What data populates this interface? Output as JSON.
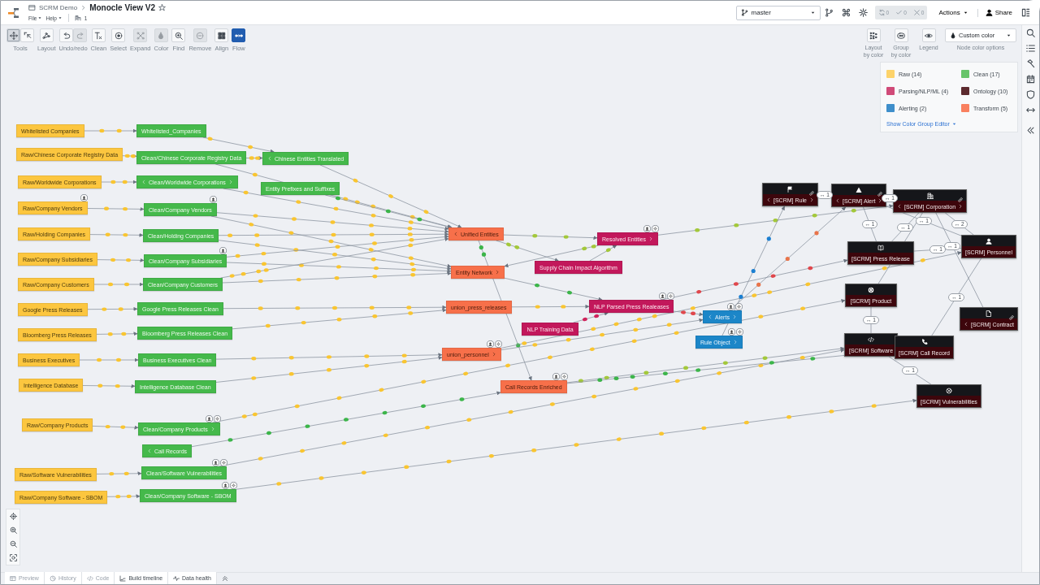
{
  "header": {
    "breadcrumb": "SCRM Demo",
    "title": "Monocle View V2",
    "menus": [
      "File",
      "Help"
    ],
    "counter": "1"
  },
  "branch": {
    "value": "master"
  },
  "checks": [
    {
      "count": "0"
    },
    {
      "count": "0"
    },
    {
      "count": "0"
    }
  ],
  "actions": "Actions",
  "share": "Share",
  "toolbar": [
    {
      "label": "Tools",
      "buttons": [
        {
          "selected": true,
          "disabled": false
        },
        {
          "selected": false,
          "disabled": false
        }
      ]
    },
    {
      "label": "Layout",
      "buttons": [
        {
          "selected": false,
          "disabled": false
        }
      ]
    },
    {
      "label": "Undo/redo",
      "buttons": [
        {
          "selected": false,
          "disabled": false
        },
        {
          "selected": false,
          "disabled": true
        }
      ]
    },
    {
      "label": "Clean",
      "buttons": [
        {
          "selected": false,
          "disabled": false
        }
      ]
    },
    {
      "label": "Select",
      "buttons": [
        {
          "selected": false,
          "disabled": false
        }
      ]
    },
    {
      "label": "Expand",
      "buttons": [
        {
          "selected": false,
          "disabled": true
        }
      ]
    },
    {
      "label": "Color",
      "buttons": [
        {
          "selected": false,
          "disabled": true
        }
      ]
    },
    {
      "label": "Find",
      "buttons": [
        {
          "selected": false,
          "disabled": false
        }
      ]
    },
    {
      "label": "Remove",
      "buttons": [
        {
          "selected": false,
          "disabled": true
        }
      ]
    },
    {
      "label": "Align",
      "buttons": [
        {
          "selected": false,
          "disabled": false
        }
      ]
    },
    {
      "label": "Flow",
      "buttons": [
        {
          "selected": true,
          "disabled": false
        }
      ]
    }
  ],
  "color_tools": [
    {
      "label": "Layout by color"
    },
    {
      "label": "Group by color"
    },
    {
      "label": "Legend"
    }
  ],
  "color_dropdown": {
    "value": "Custom color",
    "caption": "Node color options"
  },
  "legend": {
    "items": [
      {
        "label": "Raw (14)",
        "color": "#fdd36a"
      },
      {
        "label": "Clean (17)",
        "color": "#67c46a"
      },
      {
        "label": "Parsing/NLP/ML (4)",
        "color": "#d04a78"
      },
      {
        "label": "Ontology (10)",
        "color": "#5c2a2e"
      },
      {
        "label": "Alerting (2)",
        "color": "#3f8fcb"
      },
      {
        "label": "Transform (5)",
        "color": "#f9805f"
      }
    ],
    "editor_link": "Show Color Group Editor"
  },
  "nodes": [
    {
      "label": "Whitelisted Companies",
      "kind": "raw"
    },
    {
      "label": "Raw/Chinese Corporate Registry Data",
      "kind": "raw"
    },
    {
      "label": "Raw/Worldwide Corporations",
      "kind": "raw"
    },
    {
      "label": "Raw/Company Vendors",
      "kind": "raw",
      "user_badge": true
    },
    {
      "label": "Raw/Holding Companies",
      "kind": "raw"
    },
    {
      "label": "Raw/Company Subsidiaries",
      "kind": "raw"
    },
    {
      "label": "Raw/Company Customers",
      "kind": "raw"
    },
    {
      "label": "Google Press Releases",
      "kind": "raw"
    },
    {
      "label": "Bloomberg Press Releases",
      "kind": "raw"
    },
    {
      "label": "Business Executives",
      "kind": "raw"
    },
    {
      "label": "Intelligence Database",
      "kind": "raw"
    },
    {
      "label": "Raw/Company Products",
      "kind": "raw"
    },
    {
      "label": "Raw/Software Vulnerabilities",
      "kind": "raw"
    },
    {
      "label": "Raw/Company Software - SBOM",
      "kind": "raw"
    },
    {
      "label": "Whitelisted_Companies",
      "kind": "clean"
    },
    {
      "label": "Clean/Chinese Corporate Registry Data",
      "kind": "clean"
    },
    {
      "label": "Clean/Worldwide Corporations",
      "kind": "clean",
      "expand_left": true,
      "expand_right": true
    },
    {
      "label": "Clean/Company Vendors",
      "kind": "clean",
      "user_badge": true
    },
    {
      "label": "Clean/Holding Companies",
      "kind": "clean"
    },
    {
      "label": "Clean/Company Subsidiaries",
      "kind": "clean",
      "user_badge": true
    },
    {
      "label": "Clean/Company Customers",
      "kind": "clean"
    },
    {
      "label": "Google Press Releases Clean",
      "kind": "clean"
    },
    {
      "label": "Bloomberg Press Releases Clean",
      "kind": "clean"
    },
    {
      "label": "Business Executives Clean",
      "kind": "clean"
    },
    {
      "label": "Intelligence Database Clean",
      "kind": "clean"
    },
    {
      "label": "Clean/Company Products",
      "kind": "clean",
      "expand_right": true,
      "user_badge": true,
      "gear_badge": true
    },
    {
      "label": "Call Records",
      "kind": "clean",
      "expand_left": true
    },
    {
      "label": "Clean/Software Vulnerabilities",
      "kind": "clean",
      "user_badge": true,
      "gear_badge": true
    },
    {
      "label": "Clean/Company Software - SBOM",
      "kind": "clean",
      "user_badge": true,
      "gear_badge": true
    },
    {
      "label": "Chinese Entities Translated",
      "kind": "clean",
      "expand_left": true
    },
    {
      "label": "Entity Prefixes and Suffixes",
      "kind": "clean"
    },
    {
      "label": "Unified Entities",
      "kind": "transform",
      "expand_left": true
    },
    {
      "label": "Entity Network",
      "kind": "transform",
      "expand_right": true
    },
    {
      "label": "union_press_releases",
      "kind": "transform"
    },
    {
      "label": "union_personnel",
      "kind": "transform",
      "expand_right": true,
      "user_badge": true,
      "gear_badge": true
    },
    {
      "label": "Call Records Enriched",
      "kind": "transform",
      "user_badge": true,
      "gear_badge": true
    },
    {
      "label": "Resolved Entities",
      "kind": "parsing",
      "expand_right": true,
      "user_badge": true,
      "gear_badge": true
    },
    {
      "label": "Supply Chain Impact Algorithm",
      "kind": "parsing"
    },
    {
      "label": "NLP Parsed Press Realeases",
      "kind": "parsing",
      "user_badge": true,
      "gear_badge": true
    },
    {
      "label": "NLP Training Data",
      "kind": "parsing"
    },
    {
      "label": "Alerts",
      "kind": "alerting",
      "expand_left": true,
      "expand_right": true,
      "user_badge": true,
      "gear_badge": true
    },
    {
      "label": "Rule Object",
      "kind": "alerting",
      "expand_right": true,
      "user_badge": true,
      "gear_badge": true
    },
    {
      "label": "[SCRM] Rule",
      "kind": "ontology",
      "expand_left": true,
      "expand_right": true,
      "linked": true
    },
    {
      "label": "[SCRM] Alert",
      "kind": "ontology",
      "expand_left": true,
      "expand_right": true,
      "linked": true
    },
    {
      "label": "[SCRM] Corporation",
      "kind": "ontology",
      "expand_left": true,
      "expand_right": true,
      "linked": true
    },
    {
      "label": "[SCRM] Press Release",
      "kind": "ontology"
    },
    {
      "label": "[SCRM] Personnel",
      "kind": "ontology"
    },
    {
      "label": "[SCRM] Product",
      "kind": "ontology"
    },
    {
      "label": "[SCRM] Contract",
      "kind": "ontology",
      "expand_left": true,
      "linked": true
    },
    {
      "label": "[SCRM] Software",
      "kind": "ontology"
    },
    {
      "label": "[SCRM] Call Record",
      "kind": "ontology"
    },
    {
      "label": "[SCRM] Vulnerabilities",
      "kind": "ontology"
    }
  ],
  "edges": [
    {
      "kind": "flow",
      "color": "#f9c531"
    },
    {
      "kind": "flow",
      "color": "#f9c531"
    },
    {
      "kind": "flow",
      "color": "#f9c531"
    },
    {
      "kind": "flow",
      "color": "#f9c531"
    },
    {
      "kind": "flow",
      "color": "#f9c531"
    },
    {
      "kind": "flow",
      "color": "#f9c531"
    },
    {
      "kind": "flow",
      "color": "#f9c531"
    },
    {
      "kind": "flow",
      "color": "#f9c531"
    },
    {
      "kind": "flow",
      "color": "#f9c531"
    },
    {
      "kind": "flow",
      "color": "#f9c531"
    },
    {
      "kind": "flow",
      "color": "#f9c531"
    },
    {
      "kind": "flow",
      "color": "#f9c531"
    },
    {
      "kind": "flow",
      "color": "#f9c531"
    },
    {
      "kind": "flow",
      "color": "#f9c531"
    },
    {
      "kind": "flow",
      "color": "#f9c531"
    },
    {
      "kind": "flow",
      "color": "#f9c531"
    },
    {
      "kind": "flow",
      "color": "#f9c531"
    },
    {
      "kind": "flow",
      "color": "#f9c531"
    },
    {
      "kind": "flow",
      "color": "#3cb54a"
    },
    {
      "kind": "flow",
      "color": "#f9c531"
    },
    {
      "kind": "flow",
      "color": "#f9c531"
    },
    {
      "kind": "flow",
      "color": "#f9c531"
    },
    {
      "kind": "flow",
      "color": "#f9c531"
    },
    {
      "kind": "flow",
      "color": "#f9c531"
    },
    {
      "kind": "flow",
      "color": "#f9c531"
    },
    {
      "kind": "flow",
      "color": "#f9c531"
    },
    {
      "kind": "flow",
      "color": "#f9c531"
    },
    {
      "kind": "flow",
      "color": "#f9c531"
    },
    {
      "kind": "flow",
      "color": "#f9c531"
    },
    {
      "kind": "flow",
      "color": "#f9c531"
    },
    {
      "kind": "flow",
      "color": "#f9c531"
    },
    {
      "kind": "flow",
      "color": "#f9c531"
    },
    {
      "kind": "flow",
      "color": "#f9c531"
    },
    {
      "kind": "flow",
      "color": "#3cb54a"
    },
    {
      "kind": "flow",
      "color": "#f9c531"
    },
    {
      "kind": "flow",
      "color": "#f9c531"
    },
    {
      "kind": "flow",
      "color": "#a3c83a"
    },
    {
      "kind": "flow",
      "color": "#a3c83a"
    },
    {
      "kind": "flow",
      "color": "#a3c83a"
    },
    {
      "kind": "flow",
      "color": "#a3c83a"
    },
    {
      "kind": "flow",
      "color": "#3cb54a"
    },
    {
      "kind": "flow",
      "color": "#3cb54a"
    },
    {
      "kind": "flow",
      "color": "#f9c531"
    },
    {
      "kind": "flow",
      "color": "#d0245c"
    },
    {
      "kind": "flow",
      "color": "#e0474c"
    },
    {
      "kind": "flow",
      "color": "#f9c531"
    },
    {
      "kind": "flow",
      "color": "#f9c531"
    },
    {
      "kind": "flow",
      "color": "#a3c83a"
    },
    {
      "kind": "flow",
      "color": "#e0474c"
    },
    {
      "kind": "flow",
      "color": "#1b7fd1"
    },
    {
      "kind": "flow",
      "color": "#e8744a"
    },
    {
      "kind": "flow",
      "color": "#a3c83a"
    },
    {
      "kind": "flow",
      "color": "#3cb54a"
    },
    {
      "kind": "link",
      "label": "↔ 1"
    },
    {
      "kind": "link",
      "label": "↔ 1"
    },
    {
      "kind": "link",
      "label": "↔ 1"
    },
    {
      "kind": "link",
      "label": "↔ 1"
    },
    {
      "kind": "link",
      "label": "↔ 2"
    },
    {
      "kind": "link",
      "label": "↔ 1"
    },
    {
      "kind": "link",
      "label": "↔ 1"
    },
    {
      "kind": "link",
      "label": "↔ 1"
    },
    {
      "kind": "link",
      "label": "↔ 1"
    },
    {
      "kind": "link",
      "label": "↔ 1"
    },
    {
      "kind": "link",
      "label": "↔ 1"
    },
    {
      "kind": "link"
    }
  ],
  "bottom_tabs": [
    {
      "label": "Preview",
      "disabled": true
    },
    {
      "label": "History",
      "disabled": true
    },
    {
      "label": "Code",
      "disabled": true
    },
    {
      "label": "Build timeline",
      "disabled": false
    },
    {
      "label": "Data health",
      "disabled": false
    }
  ]
}
